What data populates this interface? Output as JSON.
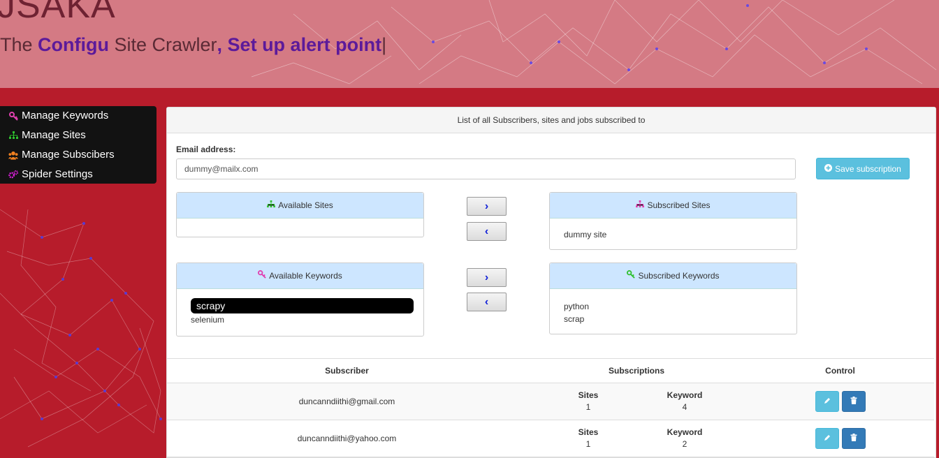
{
  "header": {
    "brand": "JSAKA",
    "tagline_prefix": "The ",
    "tagline_highlight1": "Configu",
    "tagline_middle": " Site Crawler",
    "tagline_highlight2": ", Set up alert point",
    "tagline_cursor": "|"
  },
  "sidebar": {
    "items": [
      {
        "label": "Manage Keywords",
        "icon": "key-icon",
        "color": "#e040b0"
      },
      {
        "label": "Manage Sites",
        "icon": "sitemap-icon",
        "color": "#30c030"
      },
      {
        "label": "Manage Subscibers",
        "icon": "users-icon",
        "color": "#f08020"
      },
      {
        "label": "Spider Settings",
        "icon": "cogs-icon",
        "color": "#e020e0"
      }
    ]
  },
  "panel": {
    "title": "List of all Subscribers, sites and jobs subscribed to",
    "email_label": "Email address:",
    "email_value": "dummy@mailx.com",
    "save_label": "Save subscription",
    "available_sites": {
      "title": "Available Sites",
      "items": []
    },
    "subscribed_sites": {
      "title": "Subscribed Sites",
      "items": [
        "dummy site"
      ]
    },
    "available_keywords": {
      "title": "Available Keywords",
      "items": [
        "scrapy",
        "selenium"
      ]
    },
    "subscribed_keywords": {
      "title": "Subscribed Keywords",
      "items": [
        "python",
        "scrap"
      ]
    },
    "arrow_right": "›",
    "arrow_left": "‹"
  },
  "table": {
    "headers": [
      "Subscriber",
      "Subscriptions",
      "Control"
    ],
    "sites_label": "Sites",
    "keyword_label": "Keyword",
    "rows": [
      {
        "email": "duncanndiithi@gmail.com",
        "sites": "1",
        "keywords": "4"
      },
      {
        "email": "duncanndiithi@yahoo.com",
        "sites": "1",
        "keywords": "2"
      }
    ]
  },
  "colors": {
    "background": "#b71c2b",
    "header_bg": "#d6828c",
    "highlight": "#5c1a9a",
    "info_button": "#5bc0de",
    "primary_button": "#337ab7"
  }
}
